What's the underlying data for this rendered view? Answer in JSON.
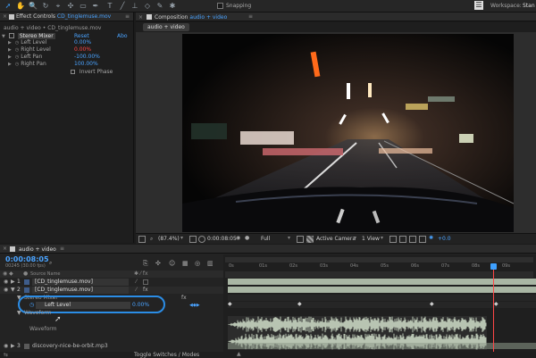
{
  "workspace": {
    "snapping_label": "Snapping",
    "workspace_label": "Workspace:",
    "workspace_value": "Stan"
  },
  "effect_controls": {
    "tab_prefix": "Effect Controls",
    "tab_file": "CD_tinglemuse.mov",
    "breadcrumb": "audio + video • CD_tinglemuse.mov",
    "effect_name": "Stereo Mixer",
    "reset_label": "Reset",
    "about_label": "Abo",
    "params": [
      {
        "label": "Left Level",
        "value": "0.00%"
      },
      {
        "label": "Right Level",
        "value": "0.00%"
      },
      {
        "label": "Left Pan",
        "value": "-100.00%"
      },
      {
        "label": "Right Pan",
        "value": "100.00%"
      }
    ],
    "invert_phase_label": "Invert Phase"
  },
  "composition": {
    "tab_prefix": "Composition",
    "tab_name": "audio + video",
    "sub_tab": "audio + video",
    "zoom": "(87.4%)",
    "timecode": "0:00:08:05",
    "resolution": "Full",
    "camera": "Active Camera",
    "views": "1 View",
    "exposure": "+0.0"
  },
  "timeline": {
    "tab_name": "audio + video",
    "timecode": "0:00:08:05",
    "fps_info": "00245 (30.00 fps)",
    "source_name_header": "Source Name",
    "ruler_labels": [
      "0s",
      "01s",
      "02s",
      "03s",
      "04s",
      "05s",
      "06s",
      "07s",
      "08s",
      "09s"
    ],
    "playhead_fraction": 0.86,
    "layers": [
      {
        "num": "1",
        "name": "[CD_tinglemuse.mov]"
      },
      {
        "num": "2",
        "name": "[CD_tinglemuse.mov]"
      },
      {
        "num": "3",
        "name": "discovery-nice-be-orbit.mp3"
      }
    ],
    "stereo_mixer_label": "Stereo Mixer",
    "left_level_label": "Left Level",
    "left_level_value": "0.00%",
    "waveform_label": "Waveform",
    "waveform_child_label": "Waveform",
    "toggle_label": "Toggle Switches / Modes"
  },
  "colors": {
    "accent": "#4aa3ff",
    "highlight_ring": "#2b8de6",
    "playhead": "#3ea0ff",
    "video_track": "#a9b6a4",
    "audio_track": "#8e9a8b"
  }
}
